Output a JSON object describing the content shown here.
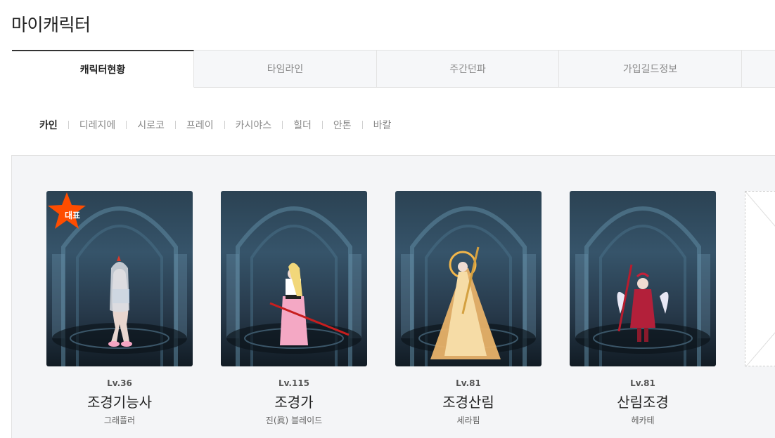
{
  "page": {
    "title": "마이캐릭터"
  },
  "tabs": [
    {
      "label": "캐릭터현황",
      "active": true
    },
    {
      "label": "타임라인",
      "active": false
    },
    {
      "label": "주간던파",
      "active": false
    },
    {
      "label": "가입길드정보",
      "active": false
    }
  ],
  "servers": [
    {
      "label": "카인",
      "active": true
    },
    {
      "label": "디레지에",
      "active": false
    },
    {
      "label": "시로코",
      "active": false
    },
    {
      "label": "프레이",
      "active": false
    },
    {
      "label": "카시야스",
      "active": false
    },
    {
      "label": "힐더",
      "active": false
    },
    {
      "label": "안톤",
      "active": false
    },
    {
      "label": "바칼",
      "active": false
    }
  ],
  "characters": [
    {
      "level": "Lv.36",
      "name": "조경기능사",
      "job": "그래플러",
      "representative_badge": "대표"
    },
    {
      "level": "Lv.115",
      "name": "조경가",
      "job": "진(眞) 블레이드"
    },
    {
      "level": "Lv.81",
      "name": "조경산림",
      "job": "세라핌"
    },
    {
      "level": "Lv.81",
      "name": "산림조경",
      "job": "헤카테"
    }
  ],
  "colors": {
    "badge": "#ff4d00",
    "active_tab_border": "#333333",
    "panel_bg": "#f4f5f7"
  }
}
